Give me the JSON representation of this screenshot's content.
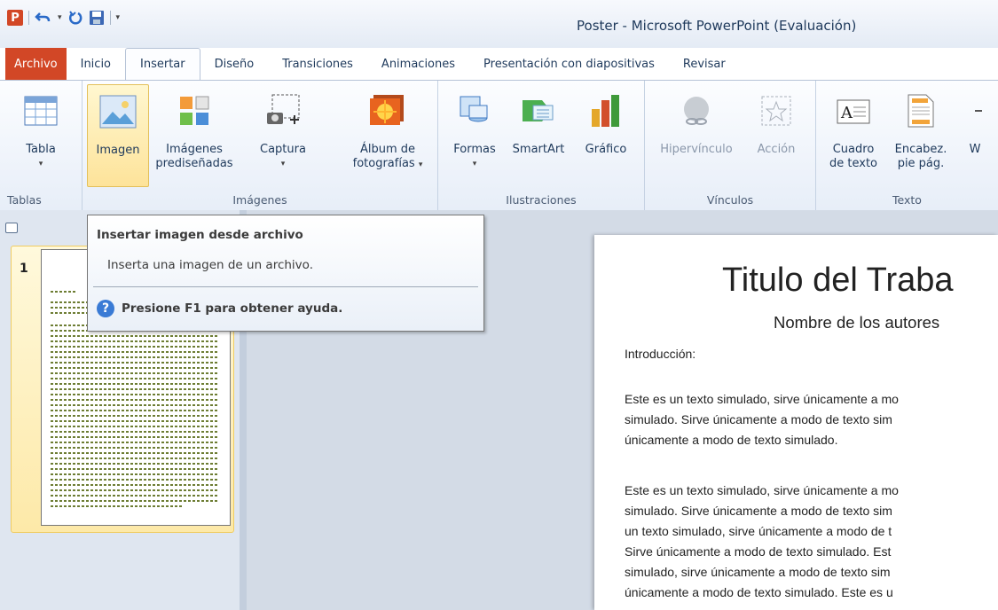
{
  "window": {
    "title": "Poster  -  Microsoft PowerPoint (Evaluación)",
    "app_logo": "P"
  },
  "tabs": [
    {
      "label": "Archivo"
    },
    {
      "label": "Inicio"
    },
    {
      "label": "Insertar"
    },
    {
      "label": "Diseño"
    },
    {
      "label": "Transiciones"
    },
    {
      "label": "Animaciones"
    },
    {
      "label": "Presentación con diapositivas"
    },
    {
      "label": "Revisar"
    }
  ],
  "ribbon": {
    "groups": {
      "tablas": "Tablas",
      "imagenes": "Imágenes",
      "ilustraciones": "Ilustraciones",
      "vinculos": "Vínculos",
      "texto": "Texto"
    },
    "buttons": {
      "tabla": "Tabla",
      "imagen": "Imagen",
      "imagenes_pre_1": "Imágenes",
      "imagenes_pre_2": "prediseñadas",
      "captura": "Captura",
      "album_1": "Álbum de",
      "album_2": "fotografías",
      "formas": "Formas",
      "smartart": "SmartArt",
      "grafico": "Gráfico",
      "hipervinculo": "Hipervínculo",
      "accion": "Acción",
      "cuadro_1": "Cuadro",
      "cuadro_2": "de texto",
      "encabez_1": "Encabez.",
      "encabez_2": "pie pág.",
      "w": "W"
    }
  },
  "tooltip": {
    "title": "Insertar imagen desde archivo",
    "description": "Inserta una imagen de un archivo.",
    "help": "Presione F1 para obtener ayuda."
  },
  "slides_pane": {
    "slide_number": "1"
  },
  "slide": {
    "title": "Titulo del Traba",
    "subtitle": "Nombre de los autores",
    "intro": "Introducción:",
    "para1": [
      "Este es un texto simulado, sirve únicamente  a mo",
      "simulado. Sirve únicamente  a modo de texto sim",
      "únicamente  a modo de texto simulado."
    ],
    "para2": [
      "Este es un texto simulado, sirve únicamente  a mo",
      "simulado. Sirve únicamente  a modo de texto sim",
      "un texto simulado, sirve únicamente  a modo de t",
      "Sirve únicamente  a modo de texto simulado. Est",
      "simulado, sirve únicamente  a modo de texto sim",
      "únicamente  a modo de texto simulado. Este es u"
    ]
  }
}
